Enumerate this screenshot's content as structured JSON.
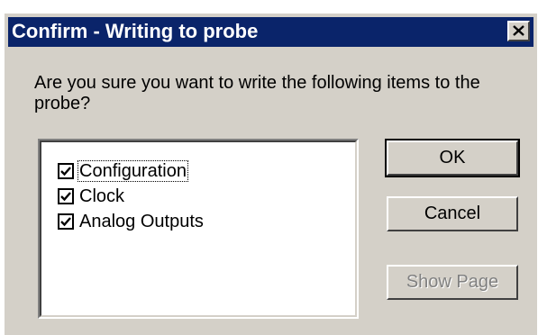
{
  "dialog": {
    "title": "Confirm - Writing to probe",
    "close_icon": "close-icon",
    "prompt": "Are you sure you want to write the following items to the probe?"
  },
  "items": [
    {
      "label": "Configuration",
      "checked": true
    },
    {
      "label": "Clock",
      "checked": true
    },
    {
      "label": "Analog Outputs",
      "checked": true
    }
  ],
  "buttons": {
    "ok": "OK",
    "cancel": "Cancel",
    "show_page": "Show Page"
  },
  "colors": {
    "titlebar": "#0a246a",
    "face": "#d4d0c8",
    "disabled_text": "#808080"
  }
}
